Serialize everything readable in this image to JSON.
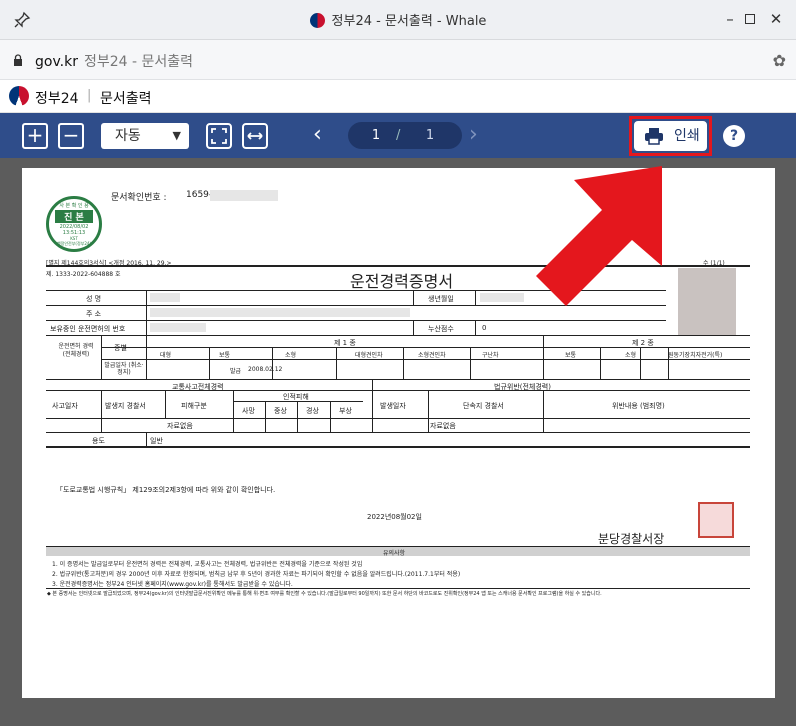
{
  "window": {
    "title": "정부24 - 문서출력 - Whale"
  },
  "urlbar": {
    "domain": "gov.kr",
    "page_title": "정부24 - 문서출력"
  },
  "site": {
    "name": "정부24",
    "separator": "|",
    "page": "문서출력"
  },
  "toolbar": {
    "zoom_in": "+",
    "zoom_out": "−",
    "zoom_value": "자동",
    "page_current": "1",
    "page_sep": "/",
    "page_total": "1",
    "print_label": "인쇄",
    "help_label": "?"
  },
  "document": {
    "confirm_label": "문서확인번호 :",
    "confirm_number": "1659-",
    "stamp_top": "사 본 확 인 용",
    "stamp_main": "진 본",
    "stamp_date": "2022/08/02",
    "stamp_time": "13:51:13",
    "stamp_tz": "KST",
    "stamp_bottom": "행정안전부(정부24)",
    "form_ref": "[별지 제144호의3서식] <개정 2016. 11. 29.>",
    "page_ref": "수 (1/1)",
    "doc_no": "제. 1333-2022-604888 호",
    "title": "운전경력증명서",
    "name_label": "성 명",
    "birth_label": "생년월일",
    "addr_label": "주 소",
    "license_no_label": "보유중인 운전면허의 번호",
    "penalty_label": "누산점수",
    "penalty_value": "0",
    "license_status_label": "운전면허 경력 (전체경력)",
    "kind_label": "종별",
    "class1": "제 1 종",
    "class2": "제 2 종",
    "cols": [
      "대형",
      "보통",
      "소형",
      "대형견인차",
      "소형견인차",
      "구난차",
      "보통",
      "소형",
      "원동기장치자전거(특)"
    ],
    "issue_label": "발급일자 (취소·정지)",
    "issue_prefix": "발급",
    "issue_date": "2008.02.12",
    "accident_header": "교통사고전체경력",
    "violation_header": "법규위반(전체경력)",
    "accident_date": "사고일자",
    "accident_station": "발생지 경찰서",
    "victim_type": "피해구분",
    "casualty_header": "인적피해",
    "casualty_cols": [
      "사망",
      "중상",
      "경상",
      "부상"
    ],
    "violation_date": "발생일자",
    "violation_station": "단속지 경찰서",
    "violation_content": "위반내용 (범죄명)",
    "no_data_1": "자료없음",
    "no_data_2": "자료없음",
    "purpose_label": "용도",
    "purpose_value": "일반",
    "law_text": "「도로교통법 시행규칙」 제129조의2제3항에 따라 위와 같이 확인합니다.",
    "issue_full_date": "2022년08월02일",
    "issuer": "분당경찰서장",
    "notes_title": "유의사항",
    "notes": [
      "1. 이 증명서는 발급일로부터 운전면허 경력은 전체경력, 교통사고는 전체경력, 법규위반은 전체경력을 기준으로 작성된 것임",
      "2. 법규위반(통고처분)의 경우 2000년 이후 자료로 한정되며, 범칙금 납부 후 5년이 경과한 자료는 파기되어 확인할 수 없음을 알려드립니다.(2011.7.1부터 적용)",
      "3. 운전경력증명서는 정부24 인터넷 홈페이지(www.gov.kr)를 통해서도 발급받을 수 있습니다."
    ],
    "footnote": "◆ 본 증명서는 인터넷으로 발급되었으며, 정부24(gov.kr)의 인터넷발급문서진위확인 메뉴를 통해 위·변조 여부를 확인할 수 있습니다.(발급일로부터 90일까지) 또한 문서 하단의 바코드로도 진위확인(정부24 앱 또는 스캐너용 문서확인 프로그램)을 하실 수 있습니다."
  },
  "colors": {
    "toolbar": "#2f4d8a",
    "highlight": "#e4171d",
    "viewer": "#5c5c5c"
  }
}
